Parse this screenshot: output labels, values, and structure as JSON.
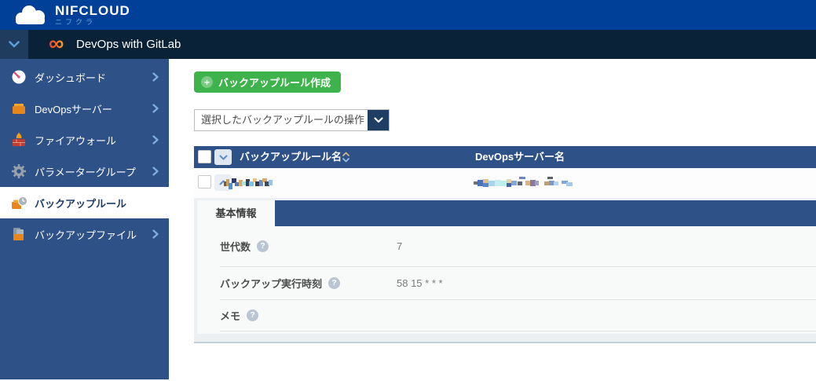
{
  "brand": {
    "name": "NIFCLOUD",
    "subname": "ニフクラ"
  },
  "service_bar": {
    "title": "DevOps with GitLab"
  },
  "sidebar": {
    "items": [
      {
        "label": "ダッシュボード",
        "icon": "dashboard-gauge-icon",
        "active": false,
        "chevron": true
      },
      {
        "label": "DevOpsサーバー",
        "icon": "server-box-icon",
        "active": false,
        "chevron": true
      },
      {
        "label": "ファイアウォール",
        "icon": "firewall-flame-icon",
        "active": false,
        "chevron": true
      },
      {
        "label": "パラメーターグループ",
        "icon": "gear-icon",
        "active": false,
        "chevron": true
      },
      {
        "label": "バックアップルール",
        "icon": "backup-clock-icon",
        "active": true,
        "chevron": false
      },
      {
        "label": "バックアップファイル",
        "icon": "backup-files-icon",
        "active": false,
        "chevron": true
      }
    ]
  },
  "toolbar": {
    "create_button_label": "バックアップルール作成",
    "bulk_action_selected": "選択したバックアップルールの操作"
  },
  "table": {
    "columns": [
      {
        "label": "バックアップルール名",
        "sortable": true
      },
      {
        "label": "DevOpsサーバー名",
        "sortable": false
      }
    ],
    "select_all_checked": false,
    "row": {
      "checked": false,
      "expanded": true,
      "name_redacted": true,
      "server_redacted": true
    }
  },
  "detail": {
    "tab_label": "基本情報",
    "fields": [
      {
        "label": "世代数",
        "value": "7",
        "help": true
      },
      {
        "label": "バックアップ実行時刻",
        "value": "58 15 * * *",
        "help": true
      },
      {
        "label": "メモ",
        "value": "",
        "help": true
      }
    ]
  },
  "icons": {
    "help": "?",
    "plus": "+",
    "gitlab_infinity": "∞"
  },
  "colors": {
    "brand_blue": "#004098",
    "dark_navy": "#0a2238",
    "sidebar_blue": "#2e5187",
    "table_header_blue": "#2e5187",
    "accent_green": "#3eb24b",
    "panel_gray": "#edf0f3",
    "content_bg": "#f8fafa"
  }
}
